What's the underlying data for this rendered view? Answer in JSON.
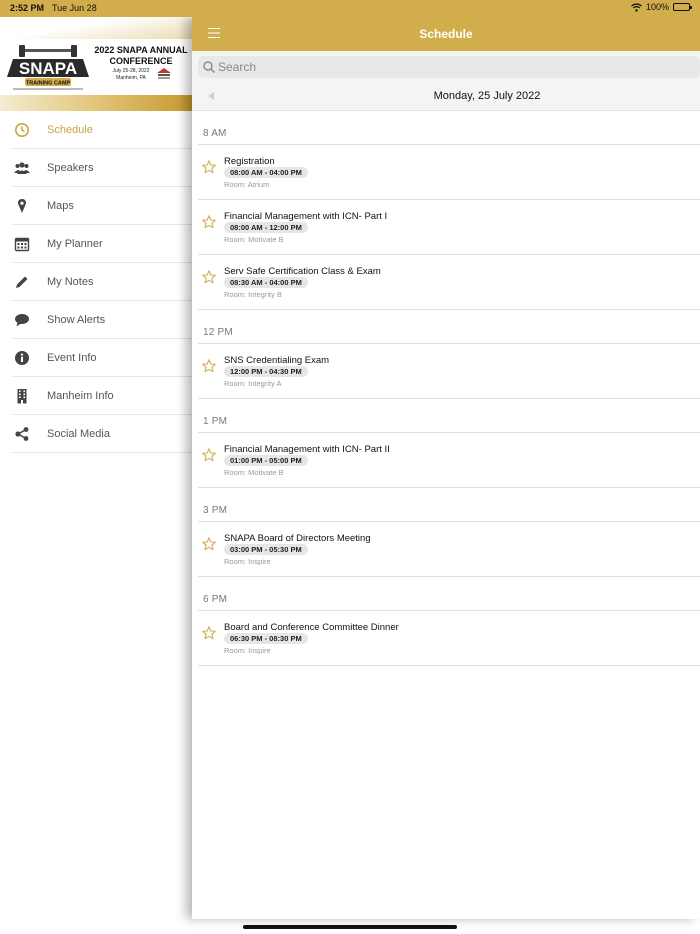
{
  "status_bar": {
    "time": "2:52 PM",
    "date": "Tue Jun 28",
    "battery": "100%"
  },
  "sidebar": {
    "logo_text": "SNAPA",
    "logo_subtext": "TRAINING CAMP",
    "banner_title": "2022 SNAPA ANNUAL CONFERENCE",
    "banner_dates": "July 25-28, 2022",
    "banner_location": "Manheim, PA",
    "items": [
      {
        "label": "Schedule",
        "icon": "clock-icon",
        "active": true
      },
      {
        "label": "Speakers",
        "icon": "people-icon"
      },
      {
        "label": "Maps",
        "icon": "map-pin-icon"
      },
      {
        "label": "My Planner",
        "icon": "calendar-icon"
      },
      {
        "label": "My Notes",
        "icon": "pencil-icon"
      },
      {
        "label": "Show Alerts",
        "icon": "speech-bubble-icon"
      },
      {
        "label": "Event Info",
        "icon": "info-icon"
      },
      {
        "label": "Manheim Info",
        "icon": "building-icon"
      },
      {
        "label": "Social Media",
        "icon": "share-icon"
      }
    ]
  },
  "header": {
    "title": "Schedule"
  },
  "search": {
    "placeholder": "Search"
  },
  "date_nav": {
    "label": "Monday, 25 July 2022"
  },
  "colors": {
    "accent": "#d2ad4c",
    "active_text": "#c9a443",
    "star": "#d2ad4c"
  },
  "schedule": [
    {
      "time": "8 AM",
      "sessions": [
        {
          "title": "Registration",
          "time": "08:00 AM - 04:00 PM",
          "room": "Room:  Atrium"
        },
        {
          "title": "Financial Management with ICN- Part I",
          "time": "08:00 AM - 12:00 PM",
          "room": "Room:  Motivate B"
        },
        {
          "title": "Serv Safe Certification Class & Exam",
          "time": "08:30 AM - 04:00 PM",
          "room": "Room:  Integrity B"
        }
      ]
    },
    {
      "time": "12 PM",
      "sessions": [
        {
          "title": "SNS Credentialing Exam",
          "time": "12:00 PM - 04:30 PM",
          "room": "Room:  Integrity A"
        }
      ]
    },
    {
      "time": "1 PM",
      "sessions": [
        {
          "title": "Financial Management with ICN- Part II",
          "time": "01:00 PM - 05:00 PM",
          "room": "Room:  Motivate B"
        }
      ]
    },
    {
      "time": "3 PM",
      "sessions": [
        {
          "title": "SNAPA Board of Directors Meeting",
          "time": "03:00 PM - 05:30 PM",
          "room": "Room:  Inspire"
        }
      ]
    },
    {
      "time": "6 PM",
      "sessions": [
        {
          "title": "Board and Conference Committee Dinner",
          "time": "06:30 PM - 08:30 PM",
          "room": "Room:  Inspire"
        }
      ]
    }
  ]
}
